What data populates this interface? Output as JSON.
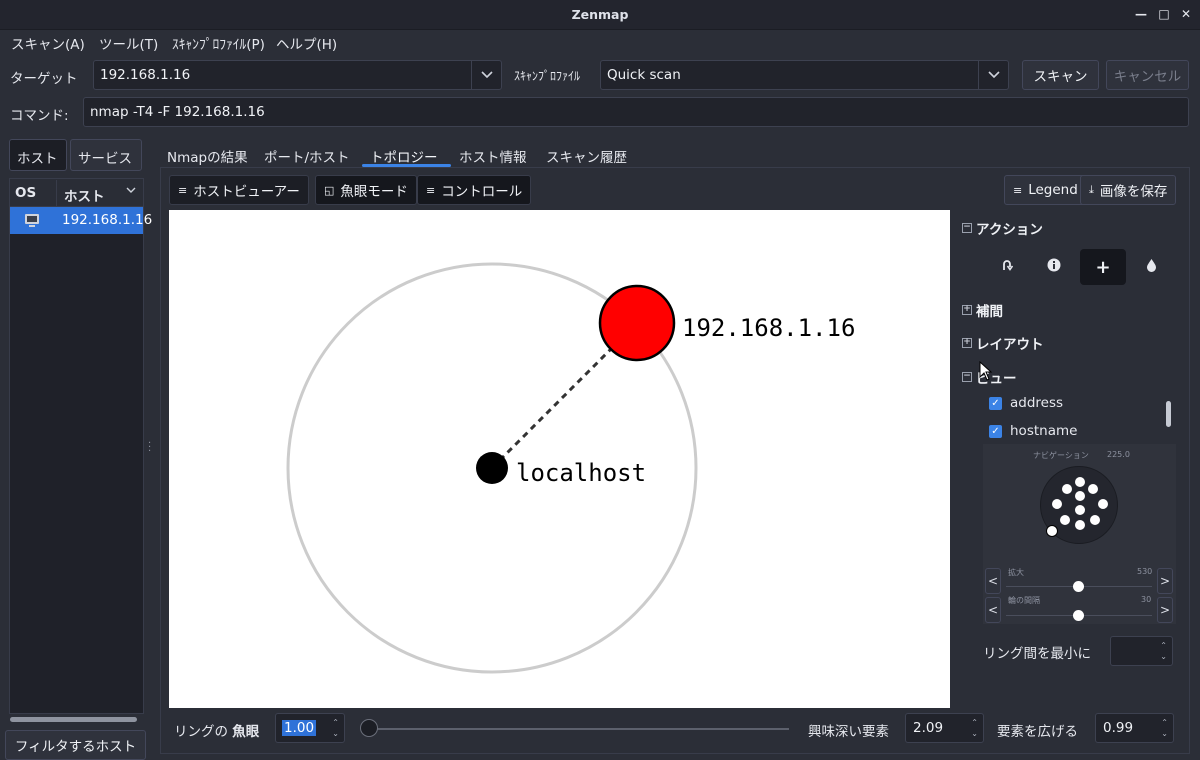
{
  "window": {
    "title": "Zenmap"
  },
  "menu": [
    "スキャン(A)",
    "ツール(T)",
    "ｽｷｬﾝﾌﾟﾛﾌｧｲﾙ(P)",
    "ヘルプ(H)"
  ],
  "target": {
    "label": "ターゲット",
    "value": "192.168.1.16"
  },
  "profile": {
    "label": "ｽｷｬﾝﾌﾟﾛﾌｧｲﾙ",
    "value": "Quick scan"
  },
  "buttons": {
    "scan": "スキャン",
    "cancel": "キャンセル"
  },
  "command": {
    "label": "コマンド:",
    "value": "nmap -T4 -F 192.168.1.16"
  },
  "left": {
    "tabs": [
      "ホスト",
      "サービス"
    ],
    "columns": {
      "os": "OS",
      "host": "ホスト"
    },
    "hosts": [
      {
        "name": "192.168.1.16"
      }
    ],
    "filter_button": "フィルタするホスト"
  },
  "tabs": [
    "Nmapの結果",
    "ポート/ホスト",
    "トポロジー",
    "ホスト情報",
    "スキャン履歴"
  ],
  "toolbar": {
    "host_viewer": "ホストビューアー",
    "fisheye": "魚眼モード",
    "controls": "コントロール",
    "legend": "Legend",
    "save_image": "画像を保存"
  },
  "topology": {
    "center_label": "localhost",
    "node_label": "192.168.1.16",
    "node_color": "#ff0000"
  },
  "controls": {
    "action": "アクション",
    "interpolation": "補間",
    "layout": "レイアウト",
    "view": "ビュー",
    "view_items": [
      {
        "label": "address",
        "checked": true
      },
      {
        "label": "hostname",
        "checked": true
      }
    ],
    "navigation_label": "ナビゲーション",
    "navigation_value": "225.0",
    "zoom_label": "拡大",
    "zoom_value": "530",
    "ring_gap_label": "輪の間隔",
    "ring_gap_value": "30",
    "min_ring_label": "リング間を最小に"
  },
  "bottom": {
    "ring_label": "リングの",
    "fisheye_label": "魚眼",
    "ring_value": "1.00",
    "interest_label": "興味深い要素",
    "interest_value": "2.09",
    "spread_label": "要素を広げる",
    "spread_value": "0.99"
  }
}
